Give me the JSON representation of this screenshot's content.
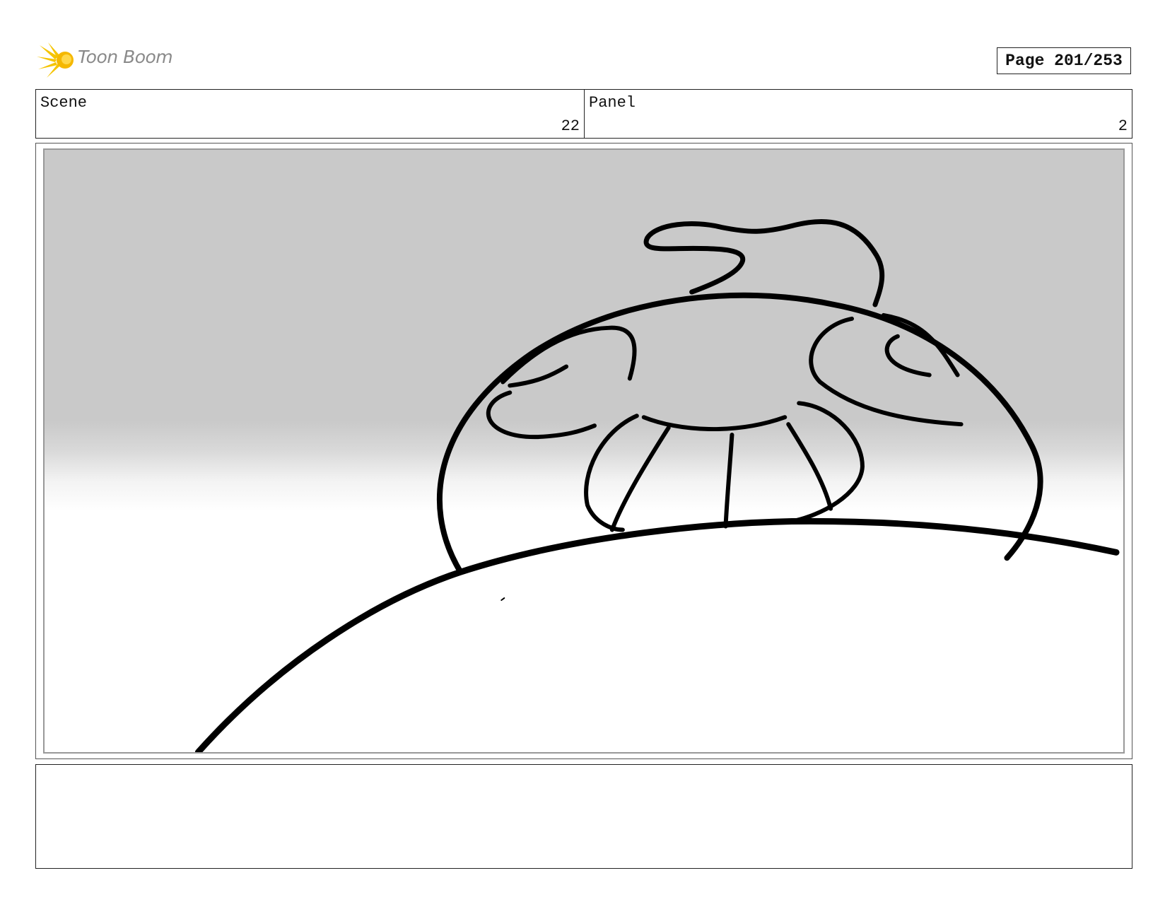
{
  "header": {
    "logo_text": "Toon Boom",
    "page_label": "Page 201/253"
  },
  "scene": {
    "label": "Scene",
    "value": "22"
  },
  "panel": {
    "label": "Panel",
    "value": "2"
  },
  "notes": {
    "text": ""
  }
}
